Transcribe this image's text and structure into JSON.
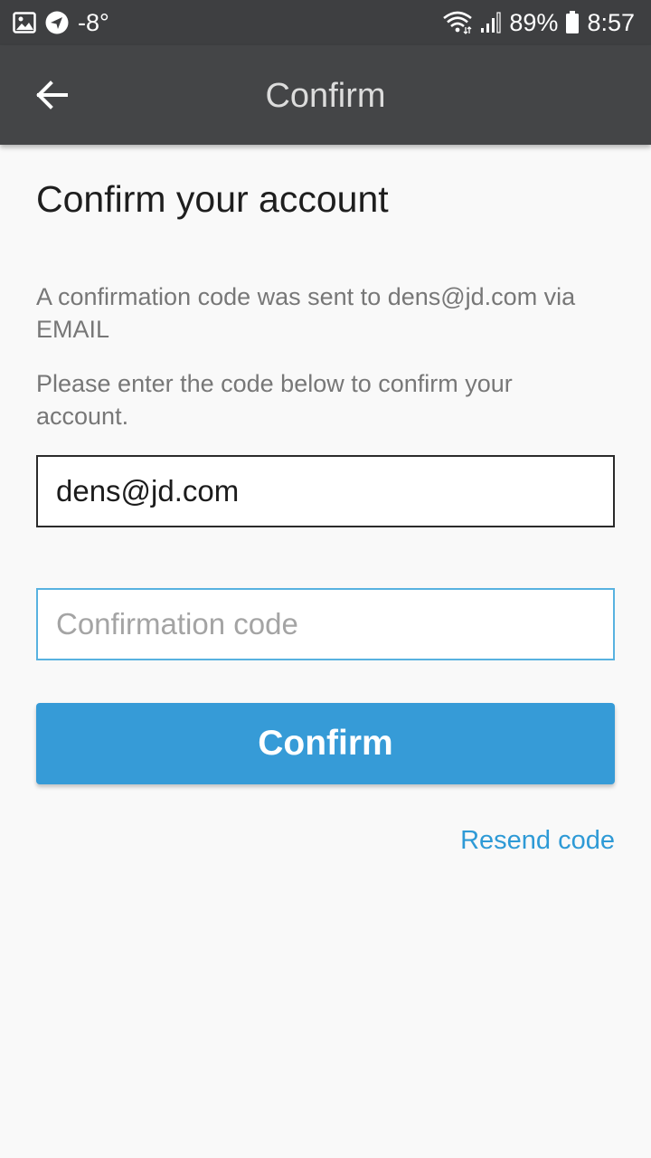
{
  "status_bar": {
    "temperature": "-8°",
    "battery": "89%",
    "time": "8:57",
    "icons": [
      "image-icon",
      "navigation-icon",
      "wifi-icon",
      "signal-icon",
      "battery-icon"
    ]
  },
  "app_bar": {
    "title": "Confirm",
    "back_icon": "arrow-left-icon"
  },
  "main": {
    "heading": "Confirm your account",
    "info_sent": "A confirmation code was sent to dens@jd.com via EMAIL",
    "info_enter": "Please enter the code below to confirm your account.",
    "email_value": "dens@jd.com",
    "code_placeholder": "Confirmation code",
    "confirm_label": "Confirm",
    "resend_label": "Resend code"
  },
  "colors": {
    "status_bar": "#3e3f41",
    "app_bar": "#444547",
    "accent": "#369bd7",
    "link": "#2e9ad6",
    "background": "#f9f9f9"
  }
}
